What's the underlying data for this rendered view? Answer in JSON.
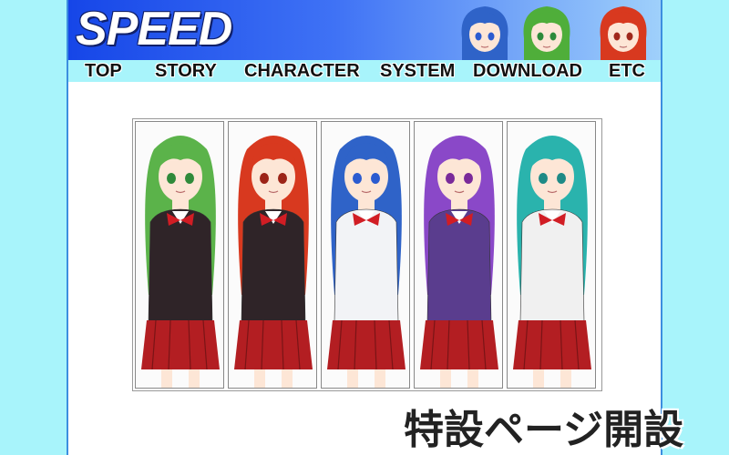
{
  "site": {
    "logo": "SPEED"
  },
  "nav": [
    {
      "label": "TOP"
    },
    {
      "label": "STORY"
    },
    {
      "label": "CHARACTER"
    },
    {
      "label": "SYSTEM"
    },
    {
      "label": "DOWNLOAD"
    },
    {
      "label": "ETC"
    }
  ],
  "header_portraits": [
    {
      "name": "blue-hair-character",
      "hair": "#2f63c8",
      "eyes": "#2b5bd0"
    },
    {
      "name": "green-hair-character",
      "hair": "#4fae3a",
      "eyes": "#2d8a3a"
    },
    {
      "name": "red-hair-character",
      "hair": "#d8391f",
      "eyes": "#a0281c"
    }
  ],
  "characters": [
    {
      "name": "green-hair-girl",
      "hair": "#5bb34a",
      "top": "#2f2428",
      "skirt": "#b31e22",
      "eyes": "#2f8a3a"
    },
    {
      "name": "red-hair-girl",
      "hair": "#d8391f",
      "top": "#2f2428",
      "skirt": "#b31e22",
      "eyes": "#9c2418"
    },
    {
      "name": "blue-hair-girl",
      "hair": "#2f63c8",
      "top": "#f2f3f6",
      "skirt": "#b31e22",
      "eyes": "#2b5bd0"
    },
    {
      "name": "purple-hair-girl",
      "hair": "#8a48c8",
      "top": "#5a3d8e",
      "skirt": "#b31e22",
      "eyes": "#7a2a9a"
    },
    {
      "name": "teal-hair-girl",
      "hair": "#2ab3ad",
      "top": "#f0f0f0",
      "skirt": "#b31e22",
      "eyes": "#1e8a86"
    }
  ],
  "announcement": "特設ページ開設",
  "colors": {
    "background": "#a8f4fb",
    "banner_start": "#1646e8",
    "banner_end": "#9fd0fb",
    "border": "#3c8ee0"
  }
}
